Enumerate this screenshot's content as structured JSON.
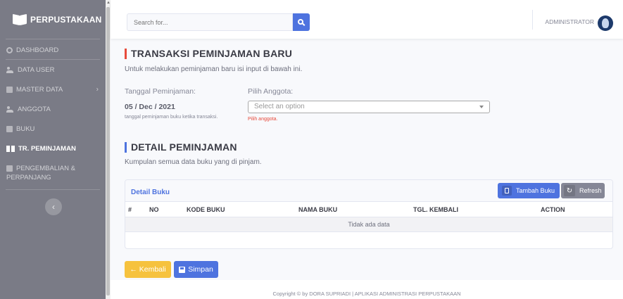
{
  "sidebar": {
    "brand": "PERPUSTAKAAN",
    "items": [
      {
        "label": "DASHBOARD",
        "icon": "dashboard-icon"
      },
      {
        "label": "DATA USER",
        "icon": "users-icon"
      },
      {
        "label": "MASTER DATA",
        "icon": "database-icon"
      },
      {
        "label": "ANGGOTA",
        "icon": "members-icon"
      },
      {
        "label": "BUKU",
        "icon": "book-icon"
      },
      {
        "label": "TR. PEMINJAMAN",
        "icon": "book-open-icon"
      },
      {
        "label": "PENGEMBALIAN &",
        "label2": "PERPANJANG",
        "icon": "return-icon"
      }
    ],
    "toggle": "‹"
  },
  "topbar": {
    "search_placeholder": "Search for...",
    "user_name": "ADMINISTRATOR"
  },
  "form": {
    "title": "TRANSAKSI PEMINJAMAN BARU",
    "subtitle": "Untuk melakukan peminjaman baru isi input di bawah ini.",
    "date_label": "Tanggal Peminjaman:",
    "date_value": "05 / Dec / 2021",
    "date_hint": "tanggal peminjaman buku ketika transaksi.",
    "member_label": "Pilih Anggota:",
    "member_placeholder": "Select an option",
    "member_error": "Pilih anggota."
  },
  "detail": {
    "title": "DETAIL PEMINJAMAN",
    "subtitle": "Kumpulan semua data buku yang di pinjam.",
    "card_title": "Detail Buku",
    "add_button": "Tambah Buku",
    "refresh_button": "Refresh",
    "columns": [
      "#",
      "NO",
      "KODE BUKU",
      "NAMA BUKU",
      "TGL. KEMBALI",
      "ACTION"
    ],
    "empty_text": "Tidak ada data"
  },
  "actions": {
    "back_label": "← Kembali",
    "save_label": "Simpan"
  },
  "footer": {
    "text": "Copyright © by DORA SUPRIADI | APLIKASI ADMINISTRASI PERPUSTAKAAN"
  },
  "colors": {
    "primary": "#4e73df",
    "warning": "#f6c23e",
    "danger": "#e74a3b",
    "secondary": "#858796",
    "sidebar": "#7a7b86"
  }
}
